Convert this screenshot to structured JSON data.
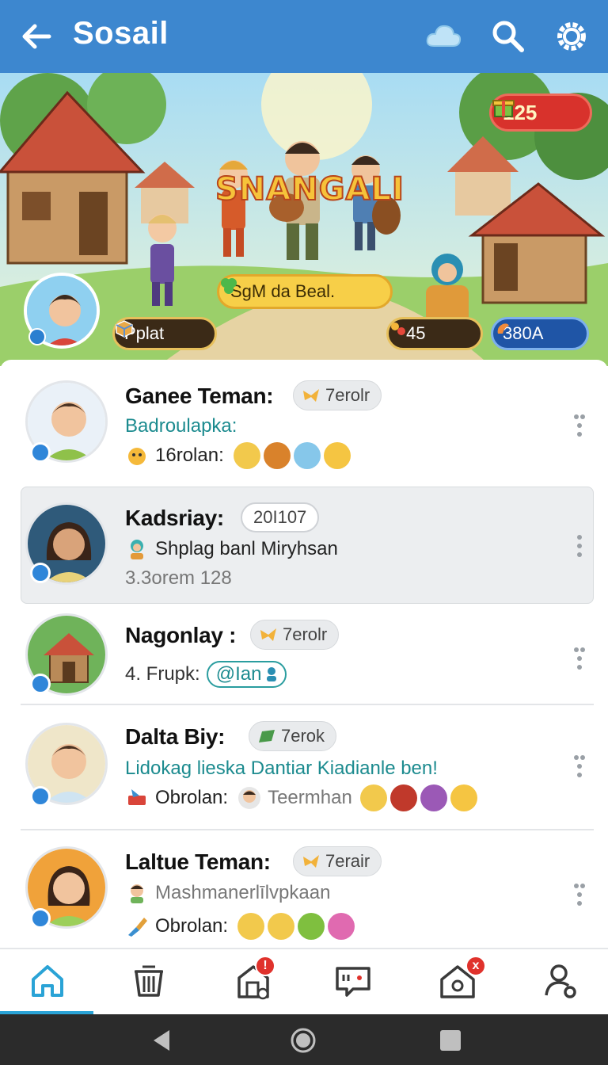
{
  "appbar": {
    "title": "Sosail",
    "icons": [
      "back-arrow-icon",
      "cloud-icon",
      "search-icon",
      "settings-icon"
    ]
  },
  "banner": {
    "game_title": "SNANGALI",
    "coin_count": "125",
    "center_pill": "SgM da Beal.",
    "left_pill": "Pplat",
    "mid_pill": "45",
    "right_pill": "380A"
  },
  "chats": [
    {
      "name": "Ganee Teman:",
      "tag": "7erolr",
      "line2": "Badroulapka:",
      "line3_label": "16rolan:",
      "emojis": [
        "#f2c94c",
        "#d9822b",
        "#86c7ea",
        "#f5c542"
      ]
    },
    {
      "name": "Kadsriay:",
      "tag": "20I107",
      "line2": "Shplag banl Miryhsan",
      "line3_label": "3.3orem 128"
    },
    {
      "name": "Nagonlay :",
      "tag": "7erolr",
      "line2_label": "4. Frupk:",
      "mention": "@Ian"
    },
    {
      "name": "Dalta Biy:",
      "tag": "7erok",
      "line2": "Lidokag lieska Dantiar Kiadianle ben!",
      "line3_label": "Obrolan:",
      "line3_user": "Teermhan",
      "emojis": [
        "#f2c94c",
        "#c0392b",
        "#9b59b6",
        "#f5c542"
      ]
    },
    {
      "name": "Laltue Teman:",
      "tag": "7erair",
      "line2": "Mashmanerlīlvpkaan",
      "line3_label": "Obrolan:",
      "emojis": [
        "#f2c94c",
        "#f2c94c",
        "#7fbf3f",
        "#e06ab0"
      ]
    }
  ],
  "bottom_nav": {
    "items": [
      "home-icon",
      "trash-icon",
      "store-icon",
      "chat-icon",
      "house-icon",
      "profile-icon"
    ],
    "badge_store": "!",
    "badge_house": "x"
  },
  "colors": {
    "appbar": "#3d87cf",
    "accent_teal": "#1c8b8f",
    "badge_red": "#e0322c"
  }
}
